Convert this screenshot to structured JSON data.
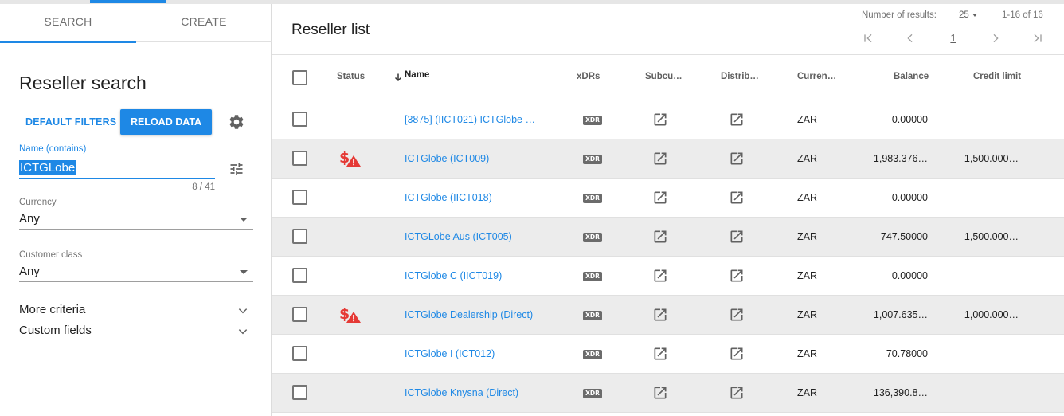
{
  "tabs": {
    "search": "SEARCH",
    "create": "CREATE"
  },
  "search_panel": {
    "title": "Reseller search",
    "default_filters": "DEFAULT FILTERS",
    "reload_data": "RELOAD DATA",
    "name_label": "Name (contains)",
    "name_value": "ICTGLobe",
    "name_counter": "8 / 41",
    "currency_label": "Currency",
    "currency_value": "Any",
    "customer_class_label": "Customer class",
    "customer_class_value": "Any",
    "more_criteria": "More criteria",
    "custom_fields": "Custom fields"
  },
  "list": {
    "title": "Reseller list",
    "results_label": "Number of results:",
    "page_size": "25",
    "range": "1-16 of 16",
    "current_page": "1",
    "columns": {
      "status": "Status",
      "name": "Name",
      "xdrs": "xDRs",
      "subcustomers": "Subcu…",
      "distributors": "Distrib…",
      "currency": "Curren…",
      "balance": "Balance",
      "credit_limit": "Credit limit"
    },
    "rows": [
      {
        "name": "[3875] (IICT021) ICTGlobe …",
        "status_alert": false,
        "xdr": "XDR",
        "currency": "ZAR",
        "balance": "0.00000",
        "credit_limit": ""
      },
      {
        "name": "ICTGlobe (ICT009)",
        "status_alert": true,
        "xdr": "XDR",
        "currency": "ZAR",
        "balance": "1,983.376…",
        "credit_limit": "1,500.000…"
      },
      {
        "name": "ICTGlobe (IICT018)",
        "status_alert": false,
        "xdr": "XDR",
        "currency": "ZAR",
        "balance": "0.00000",
        "credit_limit": ""
      },
      {
        "name": "ICTGLobe Aus (ICT005)",
        "status_alert": false,
        "xdr": "XDR",
        "currency": "ZAR",
        "balance": "747.50000",
        "credit_limit": "1,500.000…"
      },
      {
        "name": "ICTGlobe C (IICT019)",
        "status_alert": false,
        "xdr": "XDR",
        "currency": "ZAR",
        "balance": "0.00000",
        "credit_limit": ""
      },
      {
        "name": "ICTGlobe Dealership (Direct)",
        "status_alert": true,
        "xdr": "XDR",
        "currency": "ZAR",
        "balance": "1,007.635…",
        "credit_limit": "1,000.000…"
      },
      {
        "name": "ICTGlobe I (ICT012)",
        "status_alert": false,
        "xdr": "XDR",
        "currency": "ZAR",
        "balance": "70.78000",
        "credit_limit": ""
      },
      {
        "name": "ICTGlobe Knysna (Direct)",
        "status_alert": false,
        "xdr": "XDR",
        "currency": "ZAR",
        "balance": "136,390.8…",
        "credit_limit": ""
      }
    ]
  },
  "colors": {
    "accent": "#1e88e5",
    "alert": "#e53935",
    "row_alt": "#ececec"
  },
  "icons": {
    "settings": "gear-icon",
    "filter": "tune-icon",
    "open": "open-in-new-icon",
    "status": "money-alert-icon",
    "sort": "arrow-down-icon"
  }
}
